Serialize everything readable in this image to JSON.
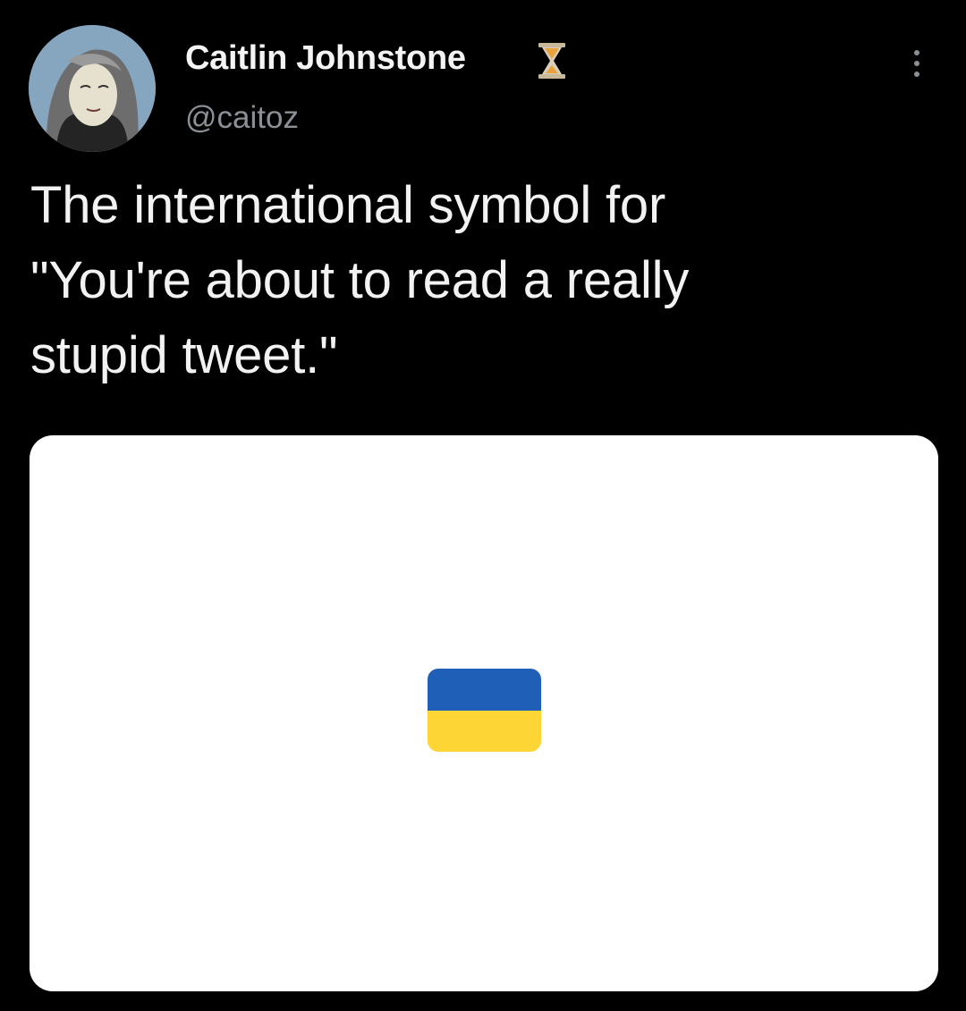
{
  "author": {
    "display_name": "Caitlin Johnstone",
    "handle": "@caitoz",
    "badge_icon": "hourglass-icon",
    "avatar_icon": "avatar-portrait"
  },
  "tweet": {
    "text_lines": [
      "The international symbol for",
      "\"You're about to read a really",
      "stupid tweet.\""
    ]
  },
  "media": {
    "icon": "ukraine-flag-emoji",
    "flag_colors": {
      "top": "#1f5fb8",
      "bottom": "#fdd534"
    }
  },
  "colors": {
    "background": "#000000",
    "text": "#f2f2f2",
    "secondary_text": "#8b9096",
    "card": "#ffffff"
  }
}
